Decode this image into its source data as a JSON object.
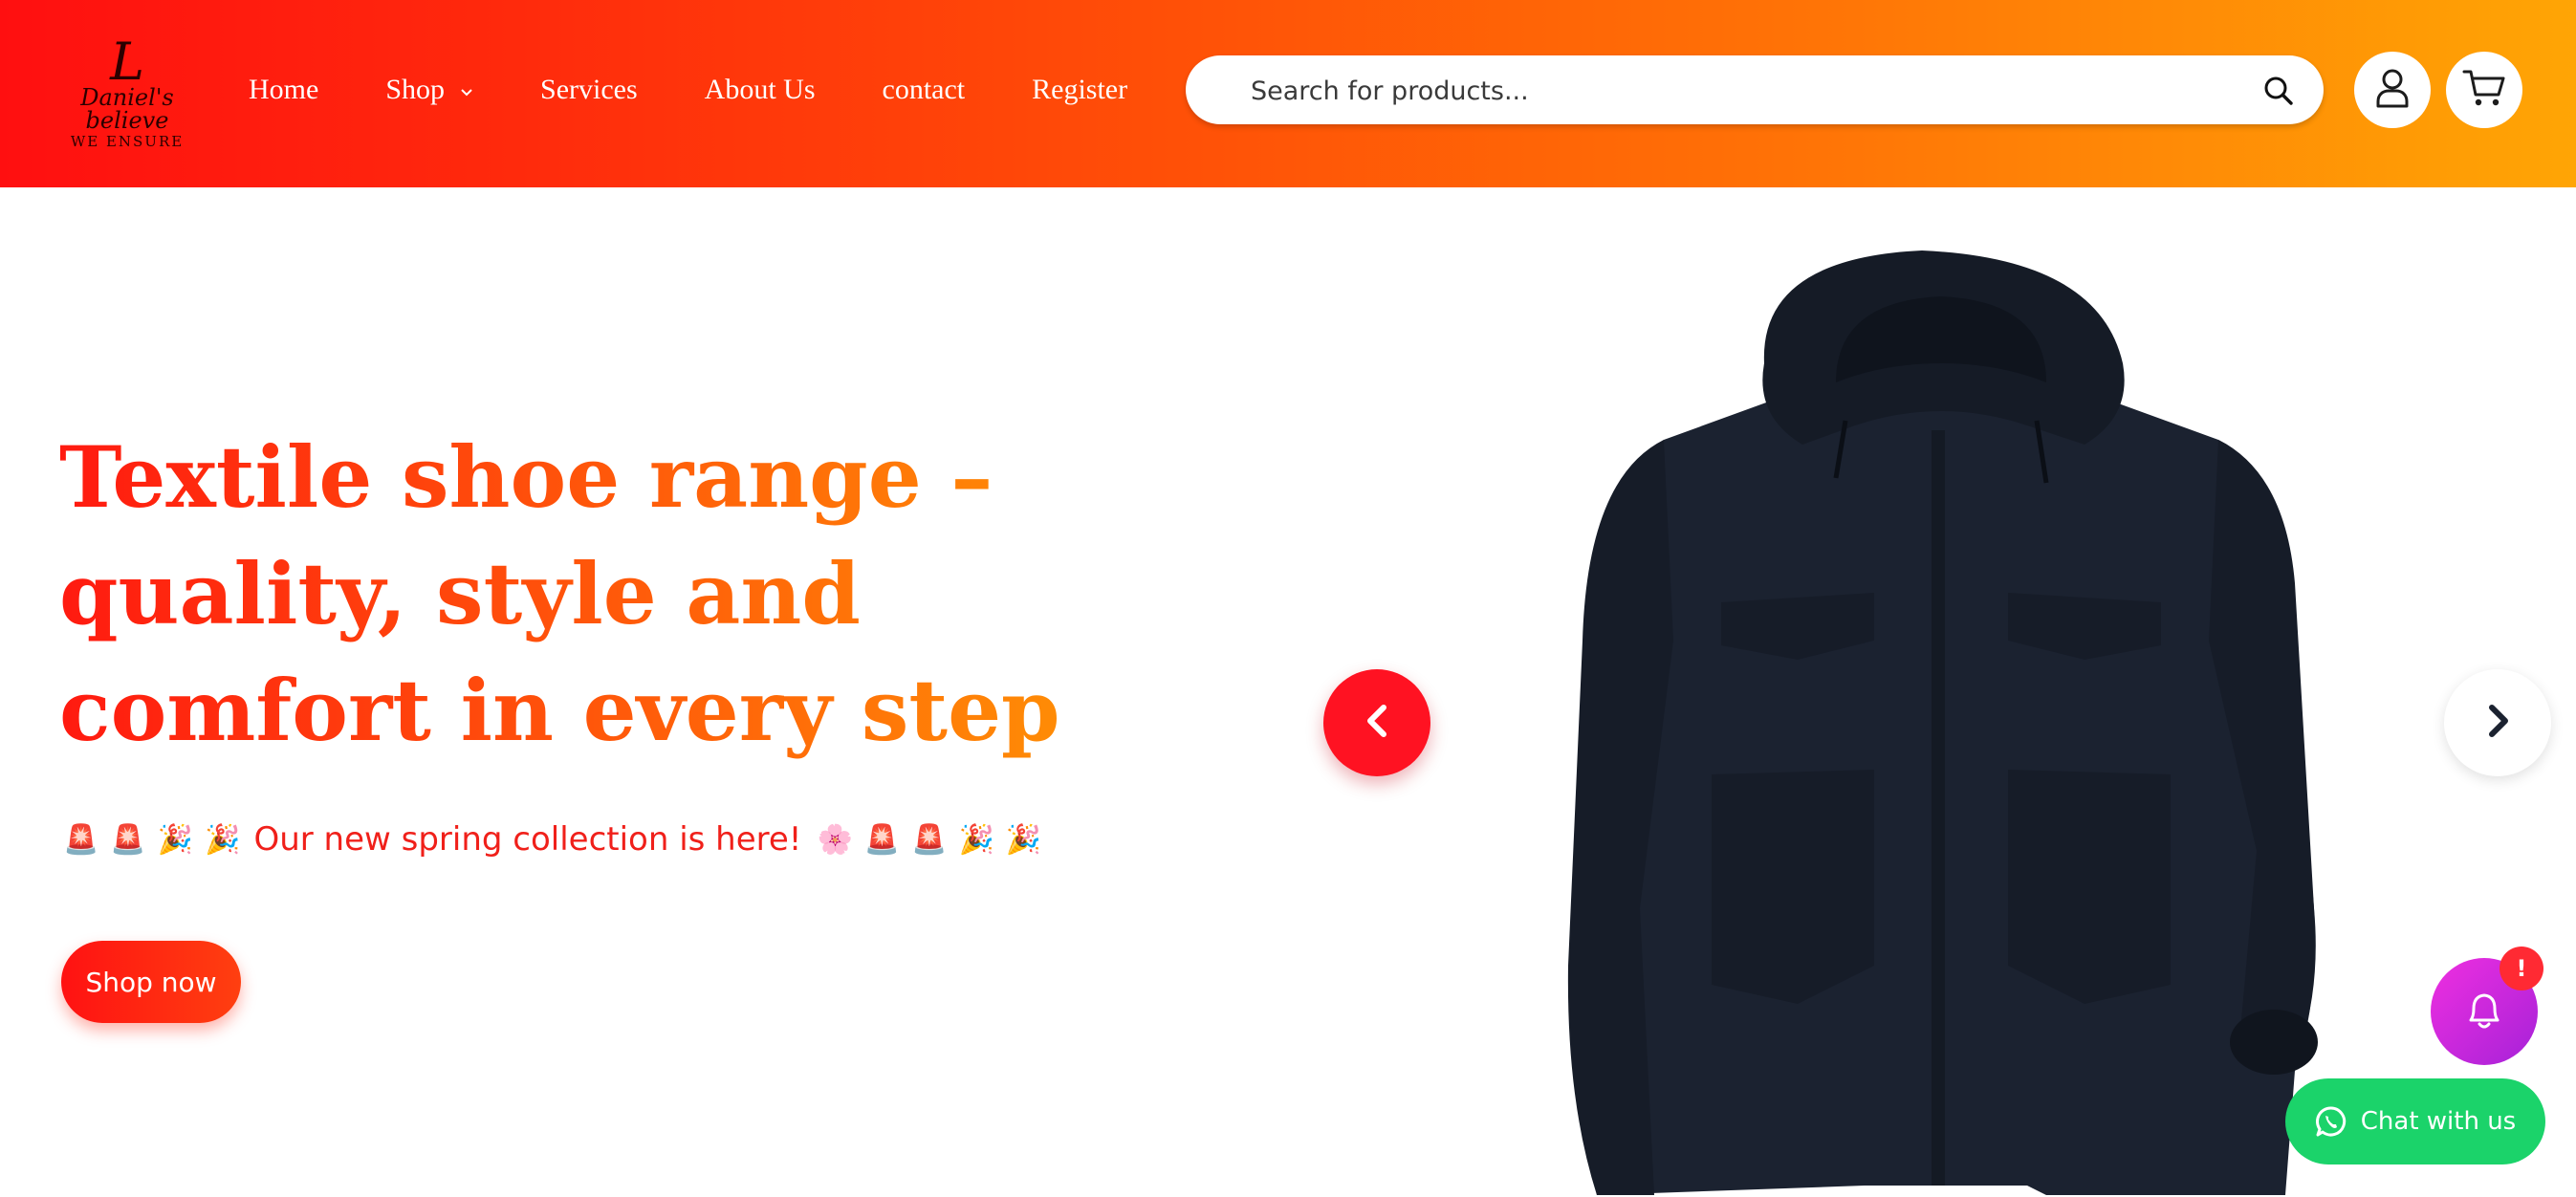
{
  "logo": {
    "mark": "L",
    "line1": "Daniel's believe",
    "line2": "WE ENSURE"
  },
  "nav": {
    "items": [
      "Home",
      "Shop",
      "Services",
      "About Us",
      "contact",
      "Register"
    ],
    "shop_chevron": "⌄"
  },
  "search": {
    "placeholder": "Search for products...",
    "icon": "search-icon"
  },
  "header_actions": {
    "account_icon": "user-icon",
    "cart_icon": "cart-icon"
  },
  "hero": {
    "title": "Textile shoe range – quality, style and comfort in every step",
    "promo_text": "Our new spring collection is here!",
    "promo_emojis_before": [
      "🚨",
      "🚨",
      "🎉",
      "🎉"
    ],
    "promo_emojis_after": [
      "🌸",
      "🚨",
      "🚨",
      "🎉",
      "🎉"
    ],
    "cta_label": "Shop now"
  },
  "slider": {
    "image": "jacket-image",
    "prev_icon": "chevron-left-icon",
    "next_icon": "chevron-right-icon"
  },
  "notification": {
    "icon": "bell-icon",
    "badge": "!"
  },
  "chat": {
    "label": "Chat with us",
    "icon": "whatsapp-icon"
  },
  "colors": {
    "header_gradient_start": "#ff0f10",
    "header_gradient_end": "#ffa505",
    "accent_red": "#ff1222",
    "chat_green": "#1bd36a",
    "notify_purple": "#c327dd",
    "jacket_navy": "#1b2230"
  }
}
